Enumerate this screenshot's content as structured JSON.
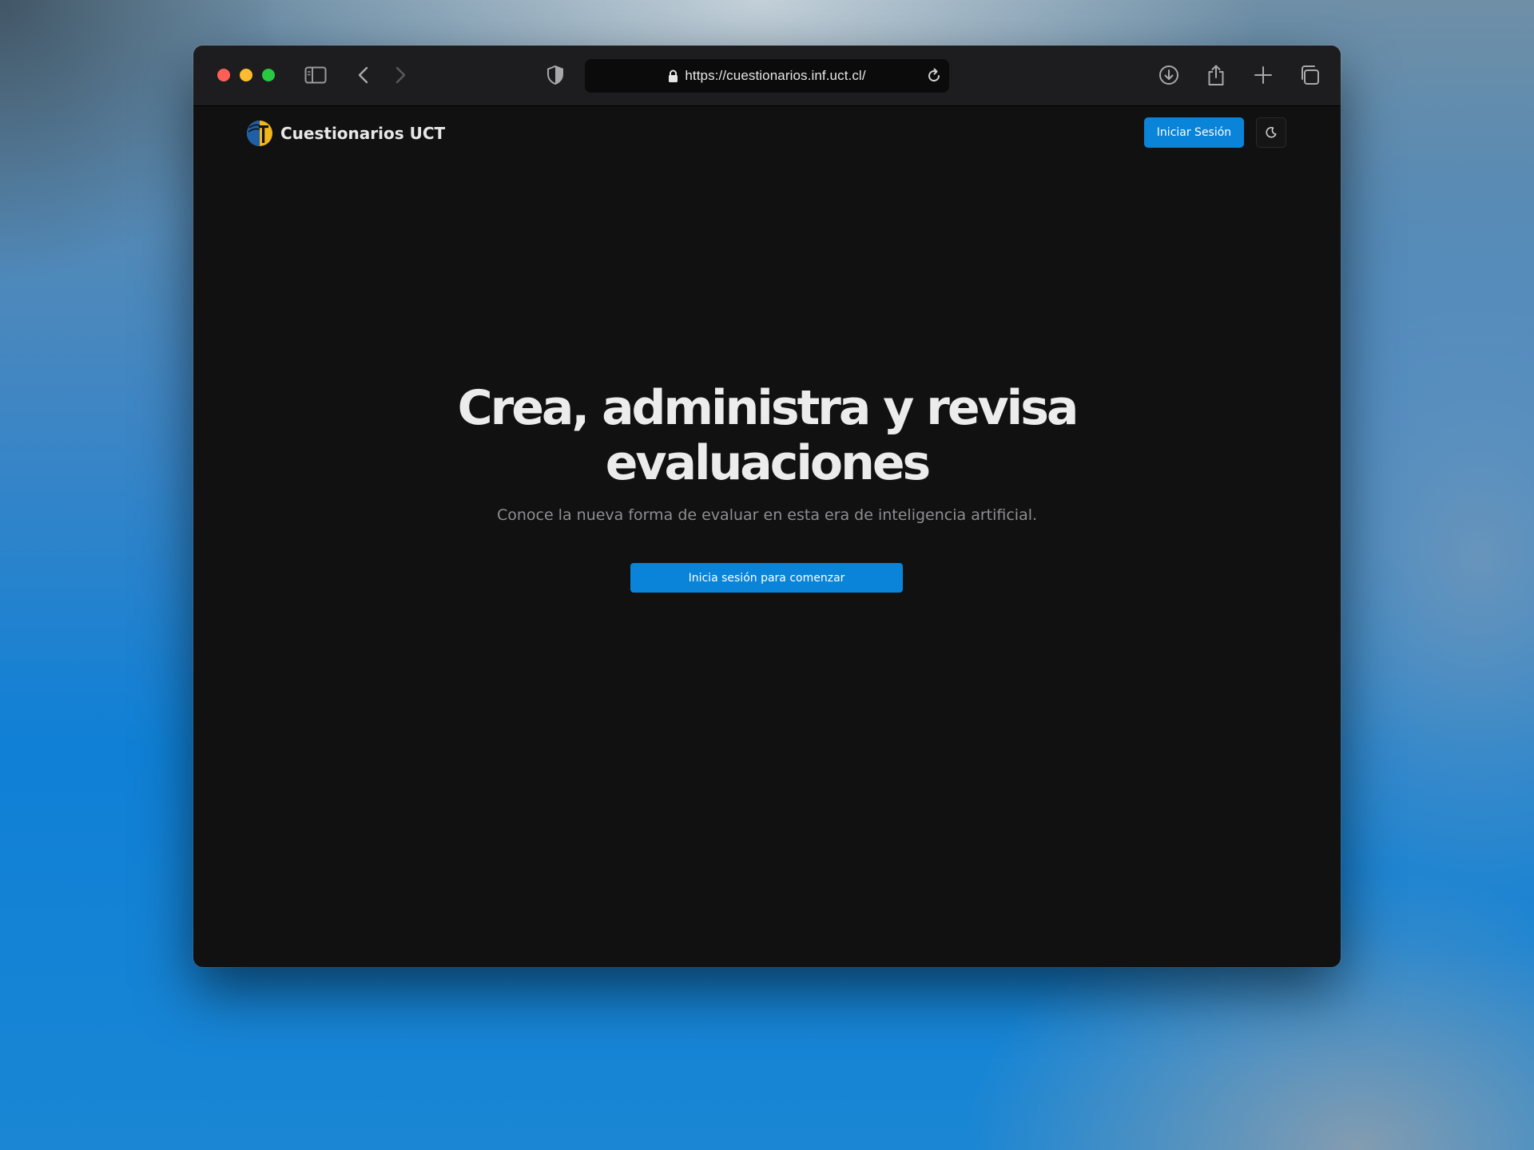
{
  "browser": {
    "url": "https://cuestionarios.inf.uct.cl/",
    "icons": [
      "sidebar-icon",
      "back-icon",
      "forward-icon",
      "shield-icon",
      "lock-icon",
      "reload-icon",
      "download-icon",
      "share-icon",
      "new-tab-icon",
      "tabs-overview-icon"
    ]
  },
  "header": {
    "brand_name": "Cuestionarios UCT",
    "signin_label": "Iniciar Sesión",
    "theme_toggle_icon": "moon-icon"
  },
  "hero": {
    "title_line1": "Crea, administra y revisa",
    "title_line2": "evaluaciones",
    "subtitle": "Conoce la nueva forma de evaluar en esta era de inteligencia artificial.",
    "cta_label": "Inicia sesión para comenzar"
  },
  "colors": {
    "accent": "#0a84d8",
    "page_background": "#111112",
    "logo_blue": "#1d5fa8",
    "logo_yellow": "#f2b51a"
  }
}
